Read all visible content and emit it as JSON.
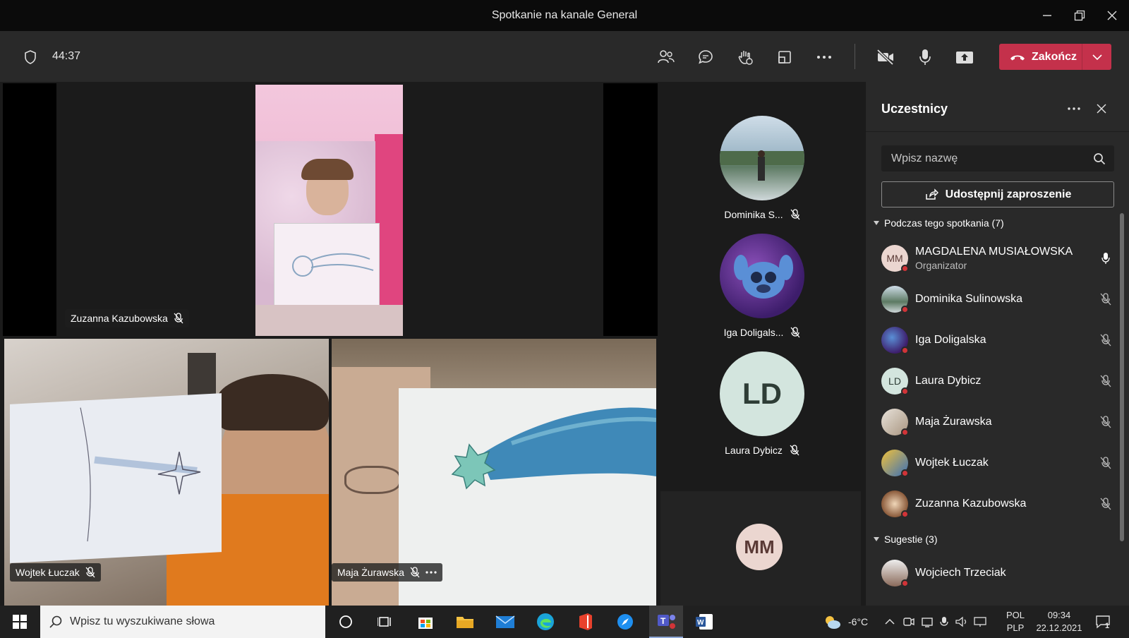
{
  "window": {
    "title": "Spotkanie na kanale General"
  },
  "toolbar": {
    "timer": "44:37",
    "end_label": "Zakończ"
  },
  "stage": {
    "main_tiles": [
      {
        "name": "Zuzanna Kazubowska"
      },
      {
        "name": "Wojtek Łuczak"
      },
      {
        "name": "Maja Żurawska"
      }
    ],
    "side_tiles": [
      {
        "name": "Dominika S..."
      },
      {
        "name": "Iga Doligals..."
      },
      {
        "name": "Laura Dybicz",
        "initials": "LD"
      },
      {
        "initials": "MM"
      }
    ]
  },
  "panel": {
    "title": "Uczestnicy",
    "search_placeholder": "Wpisz nazwę",
    "invite_label": "Udostępnij zaproszenie",
    "section_in_meeting": "Podczas tego spotkania (7)",
    "section_suggestions": "Sugestie (3)",
    "participants": [
      {
        "name": "MAGDALENA MUSIAŁOWSKA",
        "role": "Organizator",
        "initials": "MM"
      },
      {
        "name": "Dominika Sulinowska"
      },
      {
        "name": "Iga Doligalska"
      },
      {
        "name": "Laura Dybicz",
        "initials": "LD"
      },
      {
        "name": "Maja Żurawska"
      },
      {
        "name": "Wojtek Łuczak"
      },
      {
        "name": "Zuzanna Kazubowska"
      }
    ],
    "suggestions": [
      {
        "name": "Wojciech Trzeciak"
      }
    ]
  },
  "taskbar": {
    "search_placeholder": "Wpisz tu wyszukiwane słowa",
    "temperature": "-6°C",
    "lang_top": "POL",
    "lang_bottom": "PLP",
    "time": "09:34",
    "date": "22.12.2021",
    "notifications": "1"
  },
  "colors": {
    "accent_end": "#c4314b",
    "presence_red": "#d13438",
    "panel_bg": "#292929",
    "stage_bg": "#1b1b1b"
  }
}
